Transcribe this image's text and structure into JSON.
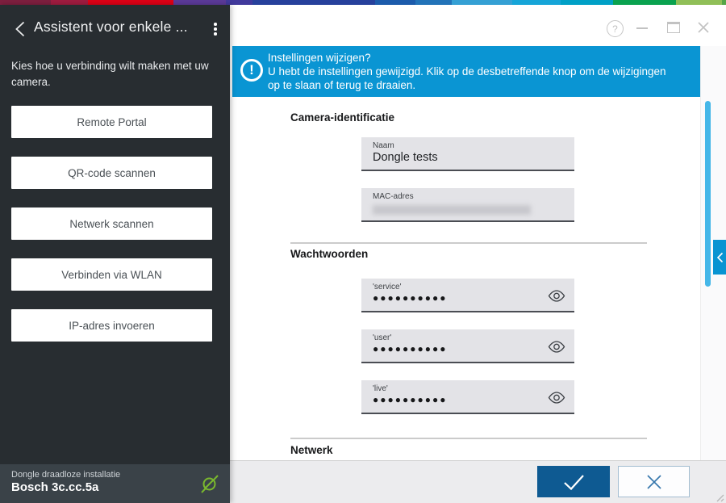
{
  "titlebar": {
    "help_glyph": "?"
  },
  "sidebar": {
    "title": "Assistent voor enkele ...",
    "description": "Kies hoe u verbinding wilt maken met uw camera.",
    "buttons": [
      {
        "label": "Remote Portal"
      },
      {
        "label": "QR-code scannen"
      },
      {
        "label": "Netwerk scannen"
      },
      {
        "label": "Verbinden via WLAN"
      },
      {
        "label": "IP-adres invoeren"
      }
    ],
    "footer": {
      "subtitle": "Dongle draadloze installatie",
      "device_name": "Bosch 3c.cc.5a"
    }
  },
  "banner": {
    "icon_glyph": "!",
    "title": "Instellingen wijzigen?",
    "message": "U hebt de instellingen gewijzigd. Klik op de desbetreffende knop om de wijzigingen op te slaan of terug te draaien."
  },
  "form": {
    "section_camera": {
      "title": "Camera-identificatie",
      "name_field": {
        "label": "Naam",
        "value": "Dongle tests"
      },
      "mac_field": {
        "label": "MAC-adres"
      }
    },
    "section_passwords": {
      "title": "Wachtwoorden",
      "fields": [
        {
          "label": "'service'",
          "value": "●●●●●●●●●●"
        },
        {
          "label": "'user'",
          "value": "●●●●●●●●●●"
        },
        {
          "label": "'live'",
          "value": "●●●●●●●●●●"
        }
      ]
    },
    "section_network": {
      "title": "Netwerk"
    }
  },
  "colors": {
    "banner_blue": "#0a95d3",
    "confirm_blue": "#0e5a92",
    "accent_green": "#7ab82e",
    "scrollbar_blue": "#45b7e8"
  }
}
